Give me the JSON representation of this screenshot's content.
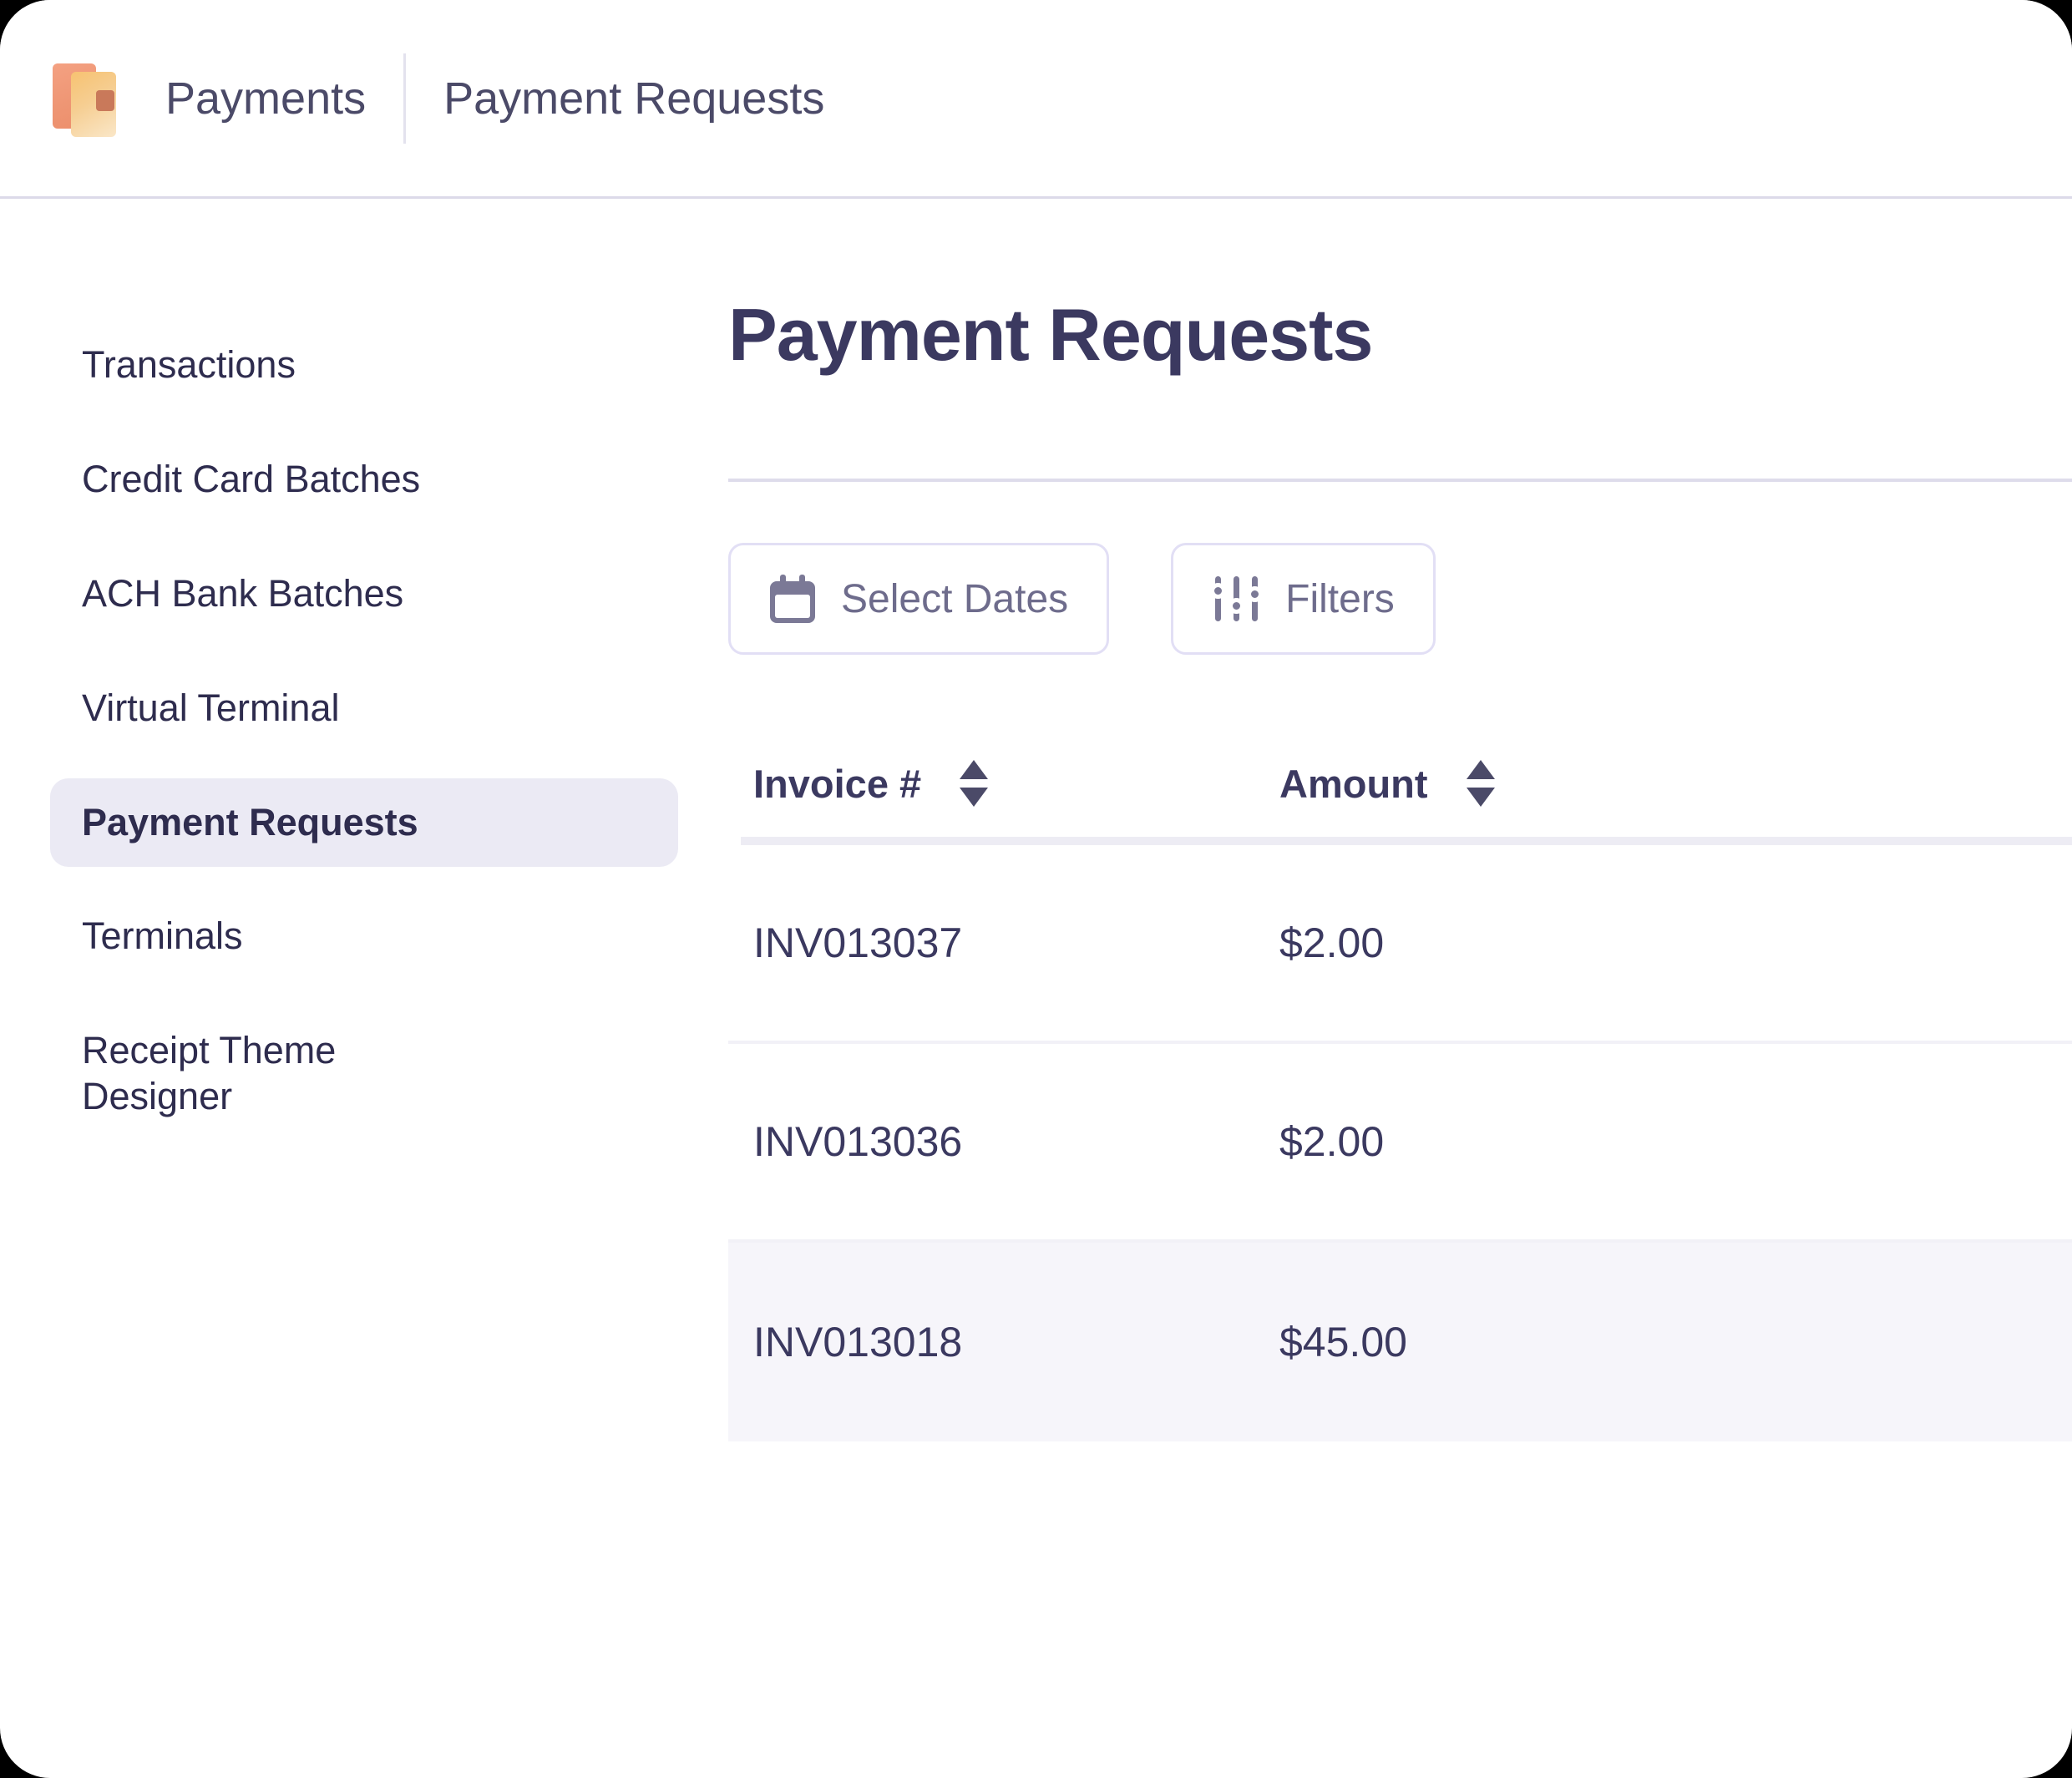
{
  "app": {
    "logo_icon": "documents-stack-icon",
    "breadcrumb": {
      "section": "Payments",
      "page": "Payment Requests"
    }
  },
  "sidebar": {
    "items": [
      {
        "label": "Transactions",
        "active": false
      },
      {
        "label": "Credit Card Batches",
        "active": false
      },
      {
        "label": "ACH Bank Batches",
        "active": false
      },
      {
        "label": "Virtual Terminal",
        "active": false
      },
      {
        "label": "Payment Requests",
        "active": true
      },
      {
        "label": "Terminals",
        "active": false
      },
      {
        "label": "Receipt Theme Designer",
        "active": false
      }
    ]
  },
  "main": {
    "page_title": "Payment Requests",
    "toolbar": {
      "select_dates_label": "Select Dates",
      "select_dates_icon": "calendar-icon",
      "filters_label": "Filters",
      "filters_icon": "sliders-icon"
    },
    "table": {
      "columns": [
        {
          "label": "Invoice #",
          "sortable": true,
          "sort_icon": "sort-updown-icon"
        },
        {
          "label": "Amount",
          "sortable": true,
          "sort_icon": "sort-updown-icon"
        }
      ],
      "rows": [
        {
          "invoice": "INV013037",
          "amount": "$2.00",
          "highlighted": false
        },
        {
          "invoice": "INV013036",
          "amount": "$2.00",
          "highlighted": false
        },
        {
          "invoice": "INV013018",
          "amount": "$45.00",
          "highlighted": true
        }
      ]
    }
  },
  "colors": {
    "text_primary": "#3B3960",
    "text_secondary": "#6E6C8C",
    "active_nav_bg": "#EBEAF4",
    "row_highlight_bg": "#F6F5FA",
    "divider": "#DEDCEB",
    "border": "#E2DFF5",
    "logo_orange": "#EE9573",
    "logo_amber": "#F7C271"
  }
}
